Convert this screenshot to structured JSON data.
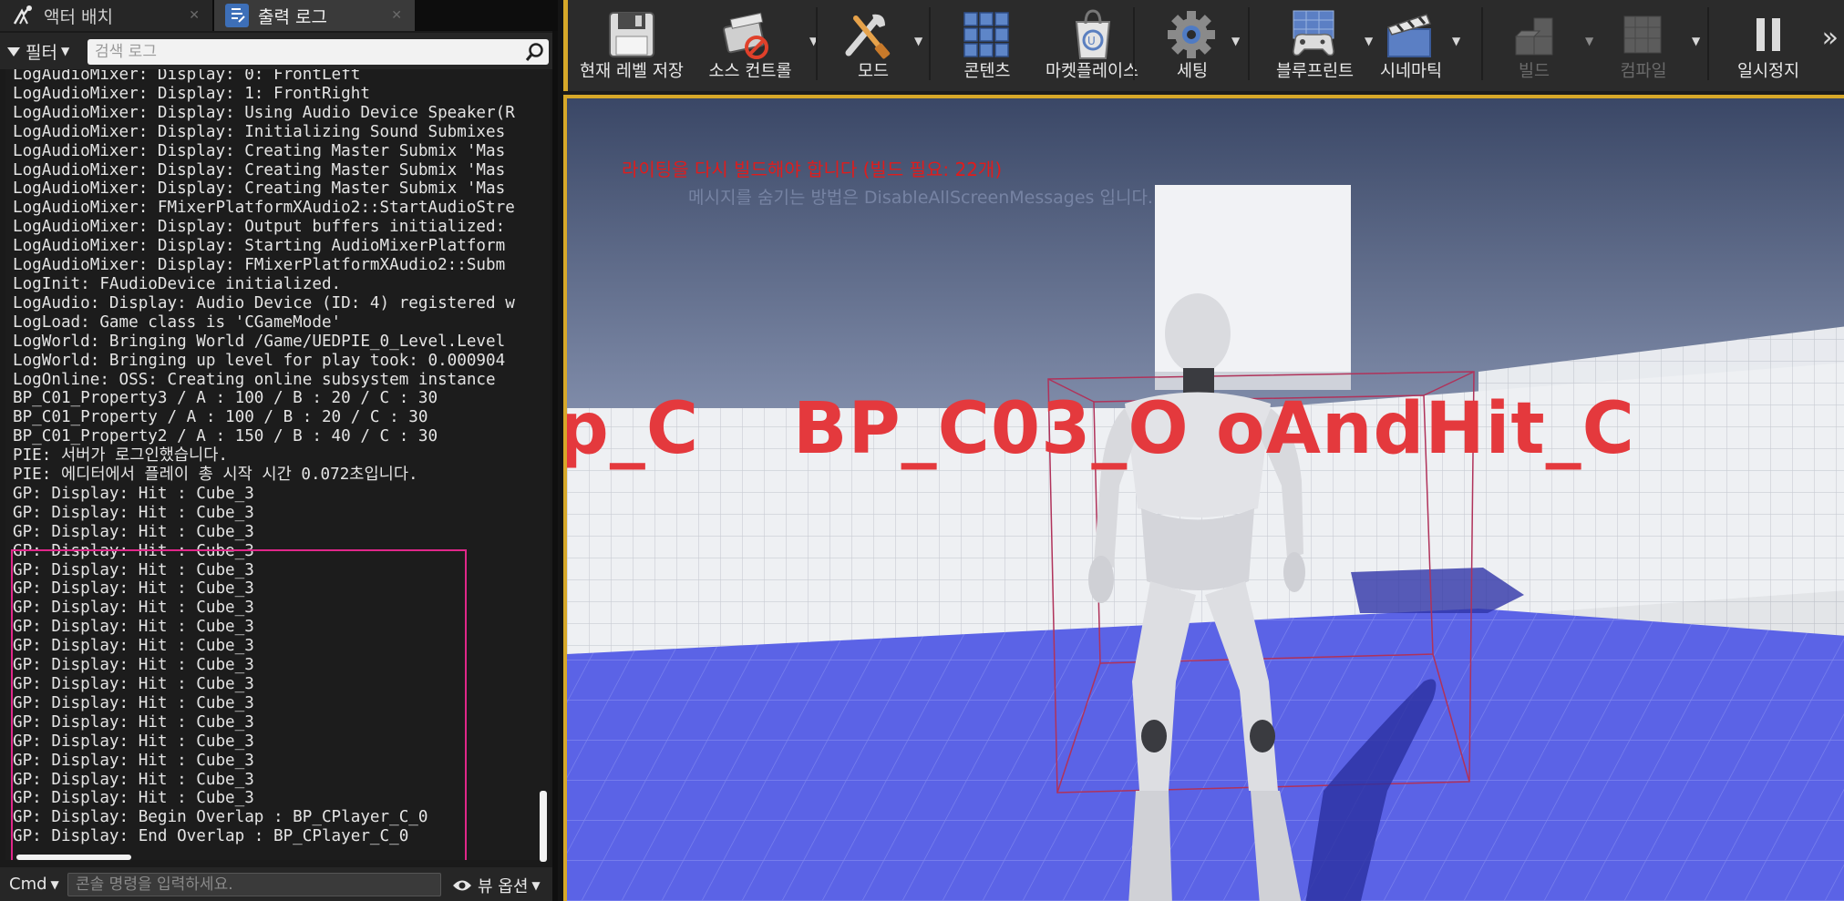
{
  "tabs": [
    {
      "label": "액터 배치",
      "icon": "actor-place-icon"
    },
    {
      "label": "출력 로그",
      "icon": "output-log-icon"
    }
  ],
  "filter": {
    "label": "필터",
    "search_placeholder": "검색 로그"
  },
  "log": {
    "lines": [
      "LogAudioMixer: Display: 0: FrontLeft",
      "LogAudioMixer: Display: 1: FrontRight",
      "LogAudioMixer: Display: Using Audio Device Speaker(R",
      "LogAudioMixer: Display: Initializing Sound Submixes",
      "LogAudioMixer: Display: Creating Master Submix 'Mas",
      "LogAudioMixer: Display: Creating Master Submix 'Mas",
      "LogAudioMixer: Display: Creating Master Submix 'Mas",
      "LogAudioMixer: FMixerPlatformXAudio2::StartAudioStre",
      "LogAudioMixer: Display: Output buffers initialized:",
      "LogAudioMixer: Display: Starting AudioMixerPlatform",
      "LogAudioMixer: Display: FMixerPlatformXAudio2::Subm",
      "LogInit: FAudioDevice initialized.",
      "LogAudio: Display: Audio Device (ID: 4) registered w",
      "LogLoad: Game class is 'CGameMode'",
      "LogWorld: Bringing World /Game/UEDPIE_0_Level.Level",
      "LogWorld: Bringing up level for play took: 0.000904",
      "LogOnline: OSS: Creating online subsystem instance",
      "BP_C01_Property3 / A : 100 / B : 20 / C : 30",
      "BP_C01_Property / A : 100 / B : 20 / C : 30",
      "BP_C01_Property2 / A : 150 / B : 40 / C : 30",
      "PIE: 서버가 로그인했습니다.",
      "PIE: 에디터에서 플레이 총 시작 시간 0.072초입니다.",
      "GP: Display: Hit : Cube_3",
      "GP: Display: Hit : Cube_3",
      "GP: Display: Hit : Cube_3",
      "GP: Display: Hit : Cube_3",
      "GP: Display: Hit : Cube_3",
      "GP: Display: Hit : Cube_3",
      "GP: Display: Hit : Cube_3",
      "GP: Display: Hit : Cube_3",
      "GP: Display: Hit : Cube_3",
      "GP: Display: Hit : Cube_3",
      "GP: Display: Hit : Cube_3",
      "GP: Display: Hit : Cube_3",
      "GP: Display: Hit : Cube_3",
      "GP: Display: Hit : Cube_3",
      "GP: Display: Hit : Cube_3",
      "GP: Display: Hit : Cube_3",
      "GP: Display: Hit : Cube_3",
      "GP: Display: Begin Overlap : BP_CPlayer_C_0",
      "GP: Display: End Overlap : BP_CPlayer_C_0"
    ]
  },
  "cmd": {
    "label": "Cmd",
    "placeholder": "콘솔 명령을 입력하세요.",
    "view_options": "뷰 옵션"
  },
  "toolbar": {
    "buttons": [
      {
        "id": "save",
        "label": "현재 레벨 저장",
        "icon": "save-icon"
      },
      {
        "id": "source",
        "label": "소스 컨트롤",
        "icon": "source-control-icon"
      },
      {
        "id": "modes",
        "label": "모드",
        "icon": "modes-icon"
      },
      {
        "id": "content",
        "label": "콘텐츠",
        "icon": "content-icon"
      },
      {
        "id": "market",
        "label": "마켓플레이스",
        "icon": "marketplace-icon"
      },
      {
        "id": "settings",
        "label": "세팅",
        "icon": "settings-icon"
      },
      {
        "id": "blueprint",
        "label": "블루프린트",
        "icon": "blueprint-icon"
      },
      {
        "id": "cinematics",
        "label": "시네마틱",
        "icon": "cinematics-icon"
      },
      {
        "id": "build",
        "label": "빌드",
        "icon": "build-icon"
      },
      {
        "id": "compile",
        "label": "컴파일",
        "icon": "compile-icon"
      },
      {
        "id": "pause",
        "label": "일시정지",
        "icon": "pause-icon"
      }
    ],
    "more": "»"
  },
  "viewport": {
    "build_message": "라이팅을 다시 빌드해야 합니다 (빌드 필요: 22개)",
    "hint_message": "메시지를 숨기는 방법은 DisableAllScreenMessages 입니다.",
    "actor_labels": [
      "p_C",
      "BP_C03_O",
      "oAndHit_C"
    ]
  },
  "colors": {
    "accent": "#d7a829",
    "highlight": "#e0278a",
    "error_text": "#e01c1c",
    "floor": "#5b63e6"
  }
}
